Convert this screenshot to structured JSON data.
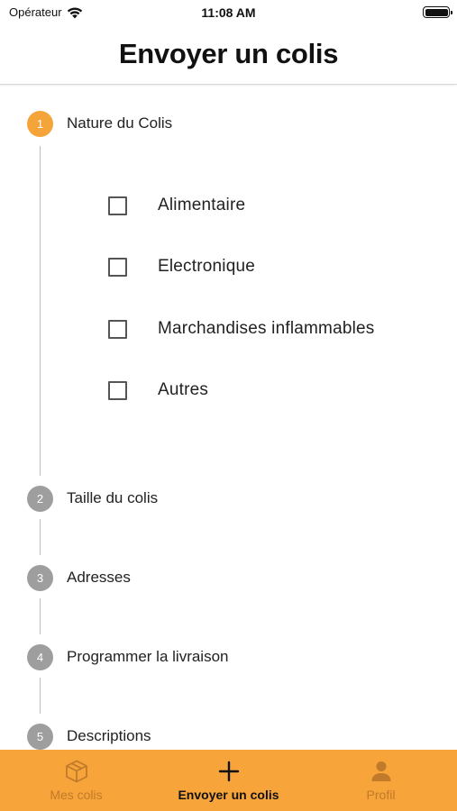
{
  "status_bar": {
    "carrier": "Opérateur",
    "time": "11:08 AM"
  },
  "header": {
    "title": "Envoyer un colis"
  },
  "stepper": {
    "steps": [
      {
        "number": "1",
        "title": "Nature du Colis",
        "active": true
      },
      {
        "number": "2",
        "title": "Taille du colis",
        "active": false
      },
      {
        "number": "3",
        "title": "Adresses",
        "active": false
      },
      {
        "number": "4",
        "title": "Programmer la livraison",
        "active": false
      },
      {
        "number": "5",
        "title": "Descriptions",
        "active": false
      }
    ],
    "options": [
      {
        "label": "Alimentaire",
        "checked": false
      },
      {
        "label": "Electronique",
        "checked": false
      },
      {
        "label": "Marchandises inflammables",
        "checked": false
      },
      {
        "label": "Autres",
        "checked": false
      }
    ]
  },
  "tab_bar": {
    "tabs": [
      {
        "label": "Mes colis",
        "icon": "box-icon",
        "active": false
      },
      {
        "label": "Envoyer un colis",
        "icon": "plus-icon",
        "active": true
      },
      {
        "label": "Profil",
        "icon": "person-icon",
        "active": false
      }
    ]
  },
  "colors": {
    "accent": "#f5a43a",
    "tab_bar_background": "#f7a43b",
    "inactive_step": "#9e9e9e"
  }
}
